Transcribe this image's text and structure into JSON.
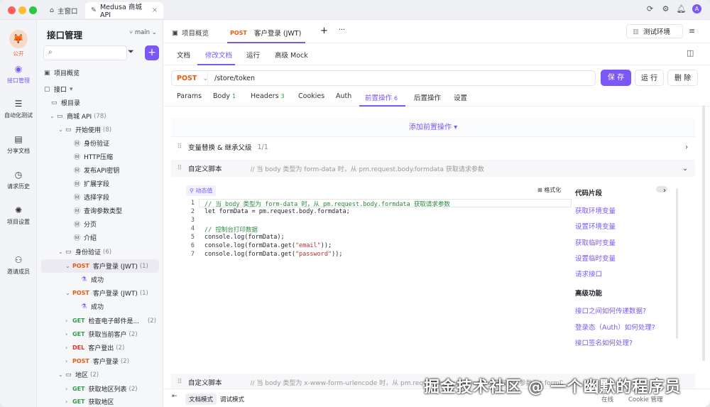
{
  "titlebar": {
    "home_tab": "主窗口",
    "project_tab": "Medusa 商城 API"
  },
  "rail": {
    "badge": "公开",
    "items": [
      {
        "label": "接口管理"
      },
      {
        "label": "自动化测试"
      },
      {
        "label": "分享文档"
      },
      {
        "label": "请求历史"
      },
      {
        "label": "项目设置"
      },
      {
        "label": "邀请成员"
      }
    ]
  },
  "tree": {
    "title": "接口管理",
    "branch": "main",
    "overview": "项目概览",
    "api_root": "接口",
    "root_dir": "根目录",
    "shop": {
      "label": "商城 API",
      "count": "(78)"
    },
    "start": {
      "label": "开始使用",
      "count": "(8)"
    },
    "docs": [
      "身份验证",
      "HTTP压缩",
      "发布API密钥",
      "扩展字段",
      "选择字段",
      "查询参数类型",
      "分页",
      "介绍"
    ],
    "auth": {
      "label": "身份验证",
      "count": "(6)"
    },
    "login1": {
      "method": "POST",
      "label": "客户登录 (JWT)",
      "count": "(1)"
    },
    "success1": "成功",
    "login2": {
      "method": "POST",
      "label": "客户登录 (JWT)",
      "count": "(1)"
    },
    "success2": "成功",
    "apis": [
      {
        "method": "GET",
        "label": "检查电子邮件是...",
        "count": "(2)"
      },
      {
        "method": "GET",
        "label": "获取当前客户",
        "count": "(2)"
      },
      {
        "method": "DEL",
        "label": "客户登出",
        "count": "(2)"
      },
      {
        "method": "POST",
        "label": "客户登录",
        "count": "(2)"
      }
    ],
    "region": {
      "label": "地区",
      "count": "(2)"
    },
    "region_apis": [
      {
        "method": "GET",
        "label": "获取地区列表",
        "count": "(2)"
      },
      {
        "method": "GET",
        "label": "获取地区",
        "count": ""
      }
    ]
  },
  "doctabs": {
    "overview": "项目概览",
    "active_method": "POST",
    "active_label": "客户登录 (JWT)",
    "plus": "+",
    "more": "···",
    "env": "测试环境"
  },
  "subtabs": [
    "文档",
    "修改文档",
    "运行",
    "高级 Mock"
  ],
  "url": {
    "method": "POST",
    "path": "/store/token",
    "save": "保 存",
    "run": "运 行",
    "delete": "删 除"
  },
  "reqtabs": [
    {
      "label": "Params",
      "n": ""
    },
    {
      "label": "Body",
      "n": "1"
    },
    {
      "label": "Headers",
      "n": "3"
    },
    {
      "label": "Cookies",
      "n": ""
    },
    {
      "label": "Auth",
      "n": ""
    },
    {
      "label": "前置操作",
      "n": "6"
    },
    {
      "label": "后置操作",
      "n": ""
    },
    {
      "label": "设置",
      "n": ""
    }
  ],
  "pre": {
    "add": "添加前置操作 ▾",
    "var": {
      "label": "变量替换 & 继承父级",
      "count": "1/1"
    },
    "script1": {
      "label": "自定义脚本",
      "desc": "// 当 body 类型为 form-data 时，从 pm.request.body.formdata 获取请求参数 let formData = pm.request.body.formdata; // 控制台打..."
    },
    "script2": {
      "label": "自定义脚本",
      "desc": "// 当 body 类型为 x-www-form-urlencode 时，从 pm.request.body.urlencoded 获取请求参数 let formData = pm.request.body.urlencoded;"
    }
  },
  "editor": {
    "dynamic": "动态值",
    "format": "格式化",
    "lines": [
      {
        "n": "1",
        "t": "// 当 body 类型为 form-data 时，从 pm.request.body.formdata 获取请求参数"
      },
      {
        "n": "2",
        "t": "let formData = pm.request.body.formdata;"
      },
      {
        "n": "3",
        "t": ""
      },
      {
        "n": "4",
        "t": "// 控制台打印数据"
      },
      {
        "n": "5",
        "t": "console.log(formData);"
      },
      {
        "n": "6",
        "t": "console.log(formData.get(\"email\"));"
      },
      {
        "n": "7",
        "t": "console.log(formData.get(\"password\"));"
      }
    ]
  },
  "snippets": {
    "title": "代码片段",
    "links": [
      "获取环境变量",
      "设置环境变量",
      "获取临时变量",
      "设置临时变量",
      "请求接口"
    ],
    "adv_title": "高级功能",
    "adv_links": [
      "接口之间如何传递数据?",
      "登录态（Auth）如何处理?",
      "接口签名如何处理?"
    ]
  },
  "bottom": {
    "doc_mode": "文档模式",
    "debug_mode": "调试模式",
    "online": "在线",
    "cookie": "Cookie 管理"
  },
  "watermark": "掘金技术社区 @ 一个幽默的程序员",
  "colors": {
    "accent": "#7b57f5",
    "post": "#e8590c",
    "get": "#2f9e44",
    "del": "#e03131"
  }
}
